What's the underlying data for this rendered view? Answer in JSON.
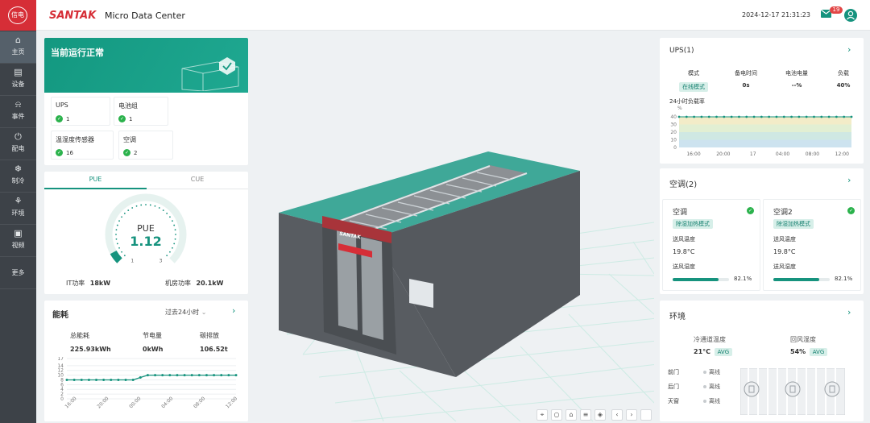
{
  "brand": {
    "name": "SANTAK",
    "app_title": "Micro Data Center",
    "logo_glyph": "信电"
  },
  "header": {
    "datetime": "2024-12-17 21:31:23",
    "mail_badge": "19"
  },
  "nav": [
    {
      "label": "主页",
      "icon": "home-icon"
    },
    {
      "label": "设备",
      "icon": "device-icon"
    },
    {
      "label": "事件",
      "icon": "bell-icon"
    },
    {
      "label": "配电",
      "icon": "plug-icon"
    },
    {
      "label": "制冷",
      "icon": "snowflake-icon"
    },
    {
      "label": "环境",
      "icon": "environment-icon"
    },
    {
      "label": "视频",
      "icon": "camera-icon"
    },
    {
      "label": "更多",
      "icon": "more-icon"
    }
  ],
  "status": {
    "title": "当前运行正常",
    "tiles": [
      {
        "label": "UPS",
        "count": "1"
      },
      {
        "label": "电池组",
        "count": "1"
      },
      {
        "label": "温湿度传感器",
        "count": "16"
      },
      {
        "label": "空调",
        "count": "2"
      }
    ]
  },
  "pue": {
    "tabs": [
      "PUE",
      "CUE"
    ],
    "label": "PUE",
    "value": "1.12",
    "value_num": 1.12,
    "min": "1",
    "max": "3",
    "it_label": "IT功率",
    "it_value": "18kW",
    "room_label": "机房功率",
    "room_value": "20.1kW"
  },
  "energy": {
    "title": "能耗",
    "range": "过去24小时",
    "stats": [
      {
        "label": "总能耗",
        "value": "225.93kWh"
      },
      {
        "label": "节电量",
        "value": "0kWh"
      },
      {
        "label": "碳排放",
        "value": "106.52t"
      }
    ]
  },
  "ups": {
    "title": "UPS(1)",
    "cols": [
      {
        "label": "模式",
        "value": "在线模式",
        "tag": true
      },
      {
        "label": "备电时间",
        "value": "0s"
      },
      {
        "label": "电池电量",
        "value": "--%"
      },
      {
        "label": "负载",
        "value": "40%"
      }
    ],
    "chart_label": "24小时负载率",
    "unit": "%"
  },
  "ac": {
    "title": "空调(2)",
    "units": [
      {
        "name": "空调",
        "mode": "除湿加热模式",
        "temp_label": "送风温度",
        "temp": "19.8°C",
        "hum_label": "送风湿度",
        "hum": "82.1%",
        "hum_num": 82.1
      },
      {
        "name": "空调2",
        "mode": "除湿加热模式",
        "temp_label": "送风温度",
        "temp": "19.8°C",
        "hum_label": "送风湿度",
        "hum": "82.1%",
        "hum_num": 82.1
      }
    ]
  },
  "env": {
    "title": "环境",
    "cold_label": "冷通道温度",
    "cold_value": "21°C",
    "hum_label": "回风湿度",
    "hum_value": "54%",
    "avg": "AVG",
    "doors": [
      {
        "label": "前门",
        "state": "离线"
      },
      {
        "label": "后门",
        "state": "离线"
      },
      {
        "label": "天窗",
        "state": "离线"
      }
    ]
  },
  "scene": {
    "rack_brand": "SANTAK"
  },
  "colors": {
    "accent": "#16937e",
    "brand_red": "#d62e37",
    "ok": "#2bb24c",
    "sidebar": "#3d4248"
  },
  "chart_data": [
    {
      "type": "line",
      "title": "能耗",
      "x": [
        "16:00",
        "17:00",
        "18:00",
        "19:00",
        "20:00",
        "21:00",
        "22:00",
        "23:00",
        "00:00",
        "01:00",
        "02:00",
        "03:00",
        "04:00",
        "05:00",
        "06:00",
        "07:00",
        "08:00",
        "09:00",
        "10:00",
        "11:00",
        "12:00",
        "13:00",
        "14:00",
        "15:00"
      ],
      "xticks": [
        "16:00",
        "20:00",
        "00:00",
        "04:00",
        "08:00",
        "12:00"
      ],
      "values": [
        8,
        8,
        8,
        8,
        8,
        8,
        8,
        8,
        8,
        8,
        9,
        10,
        10,
        10,
        10,
        10,
        10,
        10,
        10,
        10,
        10,
        10,
        10,
        10
      ],
      "yticks": [
        0,
        2,
        4,
        6,
        8,
        10,
        12,
        14,
        17
      ],
      "ylim": [
        0,
        17
      ]
    },
    {
      "type": "area",
      "title": "24小时负载率",
      "ylabel": "%",
      "xticks": [
        "16:00",
        "20:00",
        "17",
        "04:00",
        "08:00",
        "12:00"
      ],
      "values": [
        40,
        40,
        40,
        40,
        40,
        40,
        40,
        40,
        40,
        40,
        40,
        40,
        40,
        40,
        40,
        40,
        40,
        40,
        40,
        40,
        40,
        40,
        40,
        40
      ],
      "yticks": [
        0,
        10,
        20,
        30,
        40
      ],
      "ylim": [
        0,
        40
      ]
    }
  ]
}
